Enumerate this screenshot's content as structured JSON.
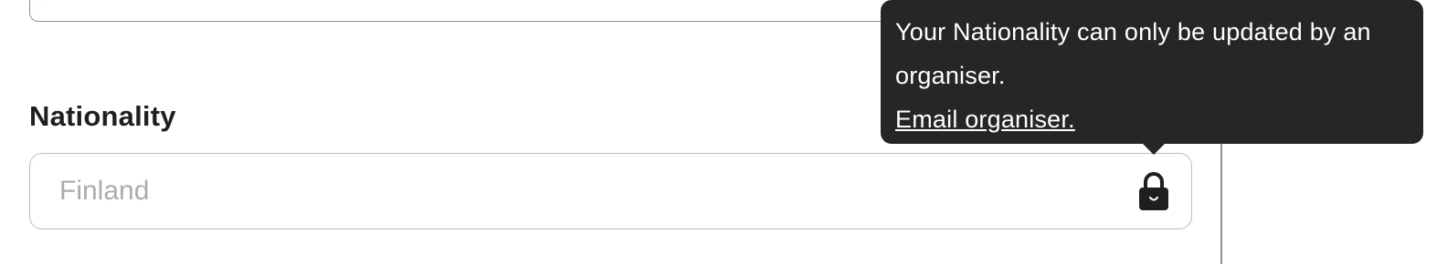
{
  "field": {
    "label": "Nationality",
    "value": "Finland",
    "locked": true,
    "icon": "lock-icon"
  },
  "tooltip": {
    "message": "Your Nationality can only be updated by an organiser.",
    "link_label": "Email organiser."
  },
  "colors": {
    "tooltip_bg": "#262626",
    "label_text": "#1f1f1f",
    "value_text": "#a8adb4",
    "input_border": "#b8bec8"
  }
}
